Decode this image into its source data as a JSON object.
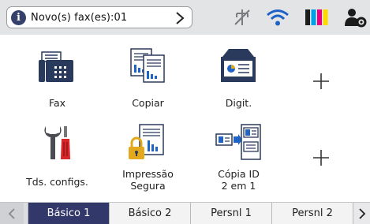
{
  "status": {
    "notification": "Novo(s) fax(es):01",
    "info_glyph": "i",
    "icons": [
      "info-icon",
      "chevron-right-icon",
      "wired-lan-off-icon",
      "wifi-icon",
      "ink-level-icon",
      "user-settings-icon"
    ],
    "ink_colors": [
      "#1c1c1c",
      "#00a0e9",
      "#e4007f",
      "#ffd800"
    ]
  },
  "tiles": [
    {
      "label": "Fax",
      "icon": "fax-icon"
    },
    {
      "label": "Copiar",
      "icon": "copy-icon"
    },
    {
      "label": "Digit.",
      "icon": "scan-icon"
    },
    {
      "label": "",
      "icon": "add-shortcut-icon"
    },
    {
      "label": "Tds. configs.",
      "icon": "tools-icon"
    },
    {
      "label": "Impressão",
      "label2": "Segura",
      "icon": "secure-print-icon"
    },
    {
      "label": "Cópia ID",
      "label2": "2 em 1",
      "icon": "id-copy-icon"
    },
    {
      "label": "",
      "icon": "add-shortcut-icon"
    }
  ],
  "tabs": [
    {
      "label": "Básico 1",
      "active": true
    },
    {
      "label": "Básico 2",
      "active": false
    },
    {
      "label": "Persnl 1",
      "active": false
    },
    {
      "label": "Persnl 2",
      "active": false
    }
  ],
  "colors": {
    "accent": "#33386a",
    "status_bar": "#e3e4e6",
    "icon_dark": "#2a3a5c",
    "icon_blue": "#1f63c6",
    "icon_gold": "#e3a81b",
    "icon_red": "#d8262b"
  }
}
